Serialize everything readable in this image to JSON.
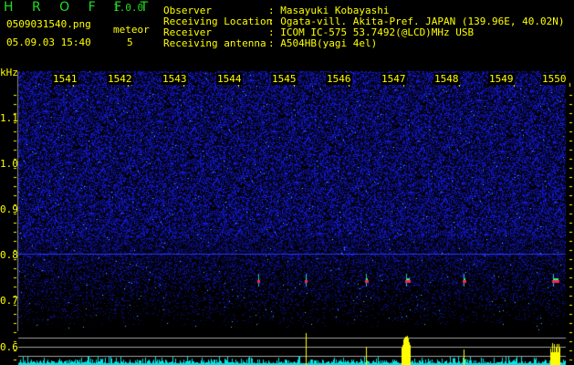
{
  "app": {
    "name": "H R O F F T",
    "version": "1.0.0"
  },
  "file": {
    "name": "0509031540.png",
    "datetime": "05.09.03 15:40"
  },
  "meteor": {
    "label": "meteor",
    "count": "5"
  },
  "info": [
    {
      "label": "Observer",
      "value": ": Masayuki Kobayashi"
    },
    {
      "label": "Receiving Location",
      "value": ": Ogata-vill. Akita-Pref. JAPAN (139.96E, 40.02N)"
    },
    {
      "label": "Receiver",
      "value": ": ICOM IC-575 53.7492(@LCD)MHz USB"
    },
    {
      "label": "Receiving antenna",
      "value": ": A504HB(yagi 4el)"
    }
  ],
  "y_axis": {
    "unit": "kHz",
    "ticks": [
      "1.1",
      "1.0",
      "0.9",
      "0.8",
      "0.7",
      "0.6"
    ]
  },
  "time_axis": {
    "ticks": [
      "1541",
      "1542",
      "1543",
      "1544",
      "1545",
      "1546",
      "1547",
      "1548",
      "1549",
      "1550"
    ]
  },
  "colors": {
    "text": "#ffff00",
    "title": "#22dd22",
    "noise": "#1a22cc",
    "histogram": "#00e5e5",
    "meteor_bar": "#ffff00",
    "guide_lines": "#a0a0a0"
  }
}
